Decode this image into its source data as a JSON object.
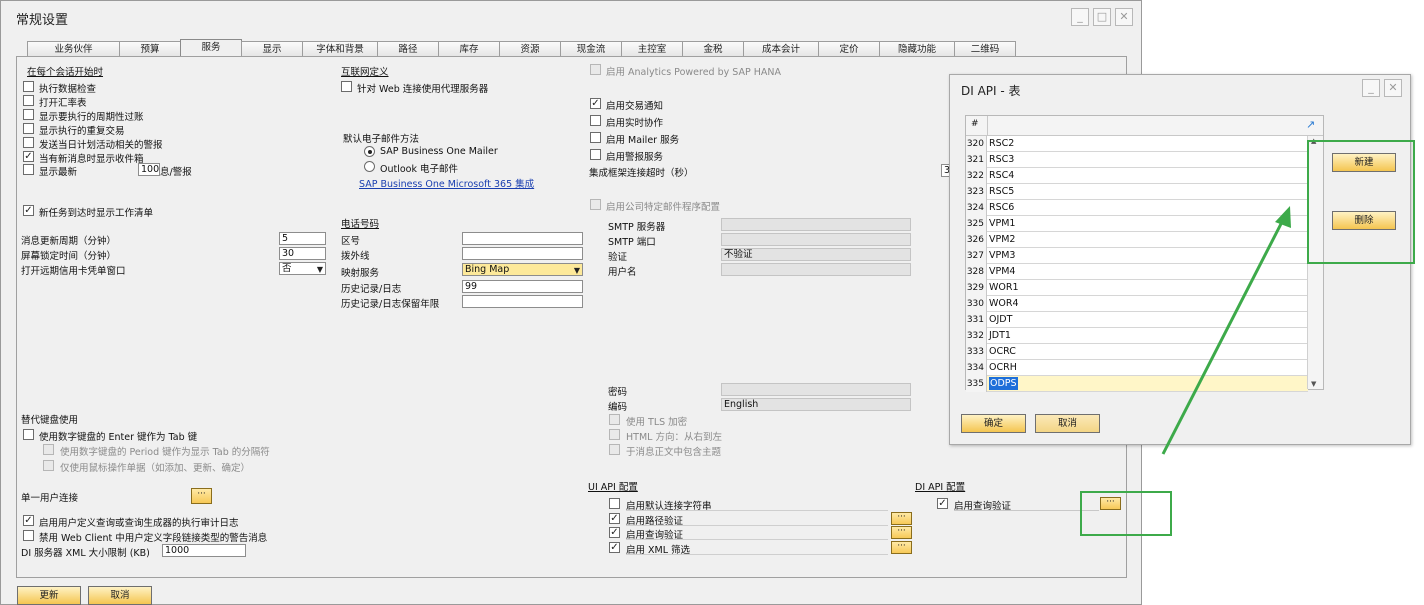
{
  "window": {
    "title": "常规设置",
    "tabs": [
      "业务伙伴",
      "预算",
      "服务",
      "显示",
      "字体和背景",
      "路径",
      "库存",
      "资源",
      "现金流",
      "主控室",
      "金税",
      "成本会计",
      "定价",
      "隐藏功能",
      "二维码"
    ],
    "active_tab": "服务",
    "footer": {
      "update_label": "更新",
      "cancel_label": "取消"
    }
  },
  "col1": {
    "session_header": "在每个会话开始时",
    "session_items": [
      {
        "label": "执行数据检查",
        "checked": false
      },
      {
        "label": "打开汇率表",
        "checked": false
      },
      {
        "label": "显示要执行的周期性过账",
        "checked": false
      },
      {
        "label": "显示执行的重复交易",
        "checked": false
      },
      {
        "label": "发送当日计划活动相关的警报",
        "checked": false
      },
      {
        "label": "当有新消息时显示收件箱",
        "checked": true
      }
    ],
    "show_latest_prefix": "显示最新",
    "show_latest_value": "100",
    "show_latest_suffix": "息/警报",
    "new_task_label": "新任务到达时显示工作清单",
    "fields": [
      {
        "label": "消息更新周期（分钟）",
        "value": "5"
      },
      {
        "label": "屏幕锁定时间（分钟）",
        "value": "30"
      },
      {
        "label": "打开远期信用卡凭单窗口",
        "value": "否"
      }
    ],
    "keyboard_header": "替代键盘使用",
    "keyboard_main": "使用数字键盘的 Enter 键作为 Tab 键",
    "keyboard_sub1": "使用数字键盘的 Period 键作为显示 Tab 的分隔符",
    "keyboard_sub2": "仅使用鼠标操作单据（如添加、更新、确定）",
    "single_user_label": "单一用户连接",
    "audit_label": "启用用户定义查询或查询生成器的执行审计日志",
    "webclient_label": "禁用 Web Client 中用户定义字段链接类型的警告消息",
    "xml_limit_label": "DI 服务器 XML 大小限制 (KB)",
    "xml_limit_value": "1000"
  },
  "col2": {
    "internet_header": "互联网定义",
    "proxy_label": "针对 Web 连接使用代理服务器",
    "email_method_label": "默认电子邮件方法",
    "radio_mailer": "SAP Business One Mailer",
    "radio_outlook": "Outlook 电子邮件",
    "ms365_link": "SAP Business One Microsoft 365 集成",
    "phone_header": "电话号码",
    "phone_fields": [
      {
        "label": "区号",
        "value": ""
      },
      {
        "label": "拨外线",
        "value": ""
      },
      {
        "label": "映射服务",
        "value": "Bing Map"
      },
      {
        "label": "历史记录/日志",
        "value": "99"
      },
      {
        "label": "历史记录/日志保留年限",
        "value": ""
      }
    ]
  },
  "col3": {
    "analytics_label": "启用 Analytics Powered by SAP HANA",
    "options": [
      {
        "label": "启用交易通知",
        "checked": true
      },
      {
        "label": "启用实时协作",
        "checked": false
      },
      {
        "label": "启用 Mailer 服务",
        "checked": false
      },
      {
        "label": "启用警报服务",
        "checked": false
      }
    ],
    "timeout_label": "集成框架连接超时（秒）",
    "timeout_value": "3",
    "company_mail_label": "启用公司特定邮件程序配置",
    "smtp_fields": [
      {
        "label": "SMTP 服务器",
        "value": ""
      },
      {
        "label": "SMTP 端口",
        "value": ""
      },
      {
        "label": "验证",
        "value": "不验证"
      },
      {
        "label": "用户名",
        "value": ""
      }
    ],
    "password_label": "密码",
    "password_value": "",
    "encoding_label": "编码",
    "encoding_value": "English",
    "tls_label": "使用 TLS 加密",
    "html_label": "HTML 方向：从右到左",
    "theme_label": "于消息正文中包含主题",
    "uiapi_header": "UI API 配置",
    "uiapi_options": [
      {
        "label": "启用默认连接字符串",
        "checked": false,
        "dots": false
      },
      {
        "label": "启用路径验证",
        "checked": true,
        "dots": true
      },
      {
        "label": "启用查询验证",
        "checked": true,
        "dots": true
      },
      {
        "label": "启用 XML 筛选",
        "checked": true,
        "dots": true
      }
    ],
    "diapi_header": "DI API 配置",
    "diapi_option": "启用查询验证"
  },
  "di_window": {
    "title": "DI API - 表",
    "header_num": "#",
    "rows": [
      {
        "num": "320",
        "value": "RSC2"
      },
      {
        "num": "321",
        "value": "RSC3"
      },
      {
        "num": "322",
        "value": "RSC4"
      },
      {
        "num": "323",
        "value": "RSC5"
      },
      {
        "num": "324",
        "value": "RSC6"
      },
      {
        "num": "325",
        "value": "VPM1"
      },
      {
        "num": "326",
        "value": "VPM2"
      },
      {
        "num": "327",
        "value": "VPM3"
      },
      {
        "num": "328",
        "value": "VPM4"
      },
      {
        "num": "329",
        "value": "WOR1"
      },
      {
        "num": "330",
        "value": "WOR4"
      },
      {
        "num": "331",
        "value": "OJDT"
      },
      {
        "num": "332",
        "value": "JDT1"
      },
      {
        "num": "333",
        "value": "OCRC"
      },
      {
        "num": "334",
        "value": "OCRH"
      },
      {
        "num": "335",
        "value": "ODPS"
      }
    ],
    "selected_row": "335",
    "new_label": "新建",
    "delete_label": "删除",
    "ok_label": "确定",
    "cancel_label": "取消"
  },
  "colors": {
    "annotation_green": "#3daa4a",
    "button_yellow": "#f4c550",
    "selected_row": "#fff6c8",
    "selected_text_bg": "#1e6fd9"
  }
}
